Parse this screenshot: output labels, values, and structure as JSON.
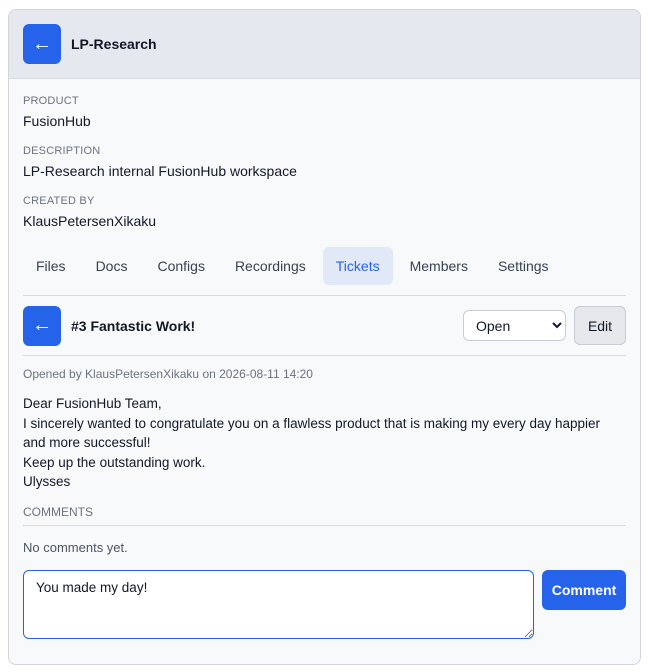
{
  "header": {
    "back_icon": "←",
    "title": "LP-Research"
  },
  "meta": {
    "product_label": "PRODUCT",
    "product_value": "FusionHub",
    "description_label": "DESCRIPTION",
    "description_value": "LP-Research internal FusionHub workspace",
    "created_by_label": "CREATED BY",
    "created_by_value": "KlausPetersenXikaku"
  },
  "tabs": [
    {
      "label": "Files"
    },
    {
      "label": "Docs"
    },
    {
      "label": "Configs"
    },
    {
      "label": "Recordings"
    },
    {
      "label": "Tickets",
      "active": true
    },
    {
      "label": "Members"
    },
    {
      "label": "Settings"
    }
  ],
  "ticket": {
    "back_icon": "←",
    "title": "#3 Fantastic Work!",
    "status": "Open",
    "status_options": [
      "Open"
    ],
    "edit_label": "Edit",
    "opened_text": "Opened by KlausPetersenXikaku on 2026-08-11 14:20",
    "message_lines": [
      "Dear FusionHub Team,",
      "I sincerely wanted to congratulate you on a flawless product that is making my every day happier and more successful!",
      "Keep up the outstanding work.",
      "Ulysses"
    ]
  },
  "comments": {
    "heading": "COMMENTS",
    "empty_text": "No comments yet.",
    "input_value": "You made my day!",
    "submit_label": "Comment"
  },
  "colors": {
    "accent": "#2563eb",
    "active_tab_bg": "#e1e8f8",
    "header_bg": "#e5e8ef"
  }
}
